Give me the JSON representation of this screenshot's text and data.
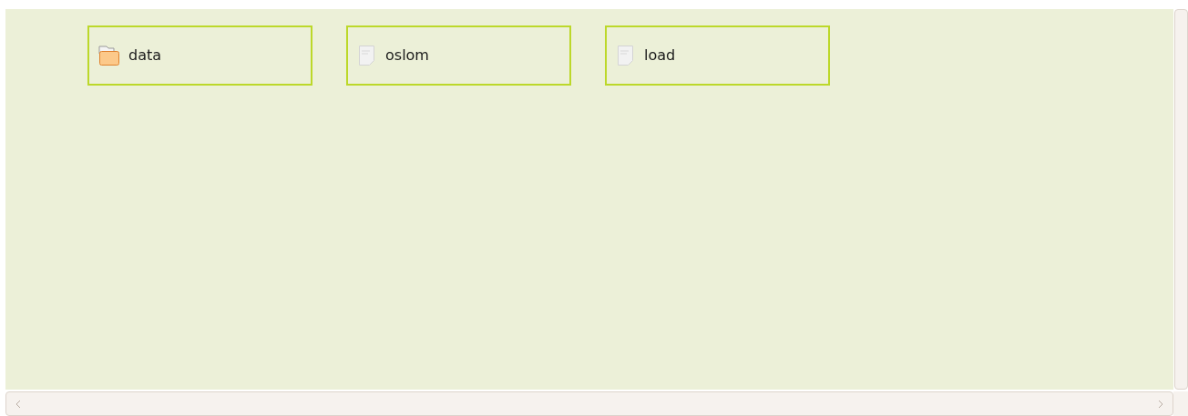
{
  "items": [
    {
      "name": "data",
      "kind": "folder",
      "selected": true
    },
    {
      "name": "oslom",
      "kind": "file",
      "selected": true
    },
    {
      "name": "load",
      "kind": "file",
      "selected": true
    }
  ]
}
